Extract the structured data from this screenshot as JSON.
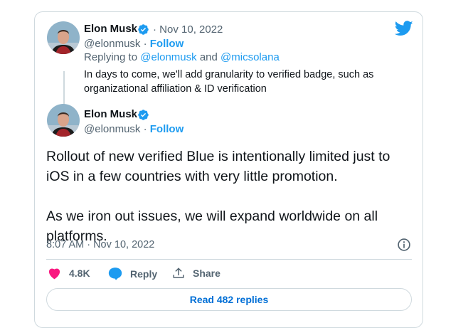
{
  "quoted_tweet": {
    "author_name": "Elon Musk",
    "date": "· Nov 10, 2022",
    "handle": "@elonmusk ·",
    "follow_label": "Follow",
    "replying_prefix": "Replying to",
    "replying_user1": "@elonmusk",
    "replying_and": "and",
    "replying_user2": "@micsolana",
    "text_line1": "In days to come, we'll add granularity to verified badge, such as",
    "text_line2": "organizational affiliation & ID verification"
  },
  "main_tweet": {
    "author_name": "Elon Musk",
    "handle": "@elonmusk ·",
    "follow_label": "Follow",
    "text": "Rollout of new verified Blue is intentionally limited just to\niOS in a few countries with very little promotion.\n\nAs we iron out issues, we will expand worldwide on all\nplatforms.",
    "timestamp": "8:07 AM · Nov 10, 2022"
  },
  "actions": {
    "like_count": "4.8K",
    "reply_label": "Reply",
    "share_label": "Share"
  },
  "read_replies_label": "Read 482 replies",
  "colors": {
    "accent": "#1d9bf0",
    "like": "#f91880",
    "border": "#cfd9de",
    "muted": "#536471"
  }
}
